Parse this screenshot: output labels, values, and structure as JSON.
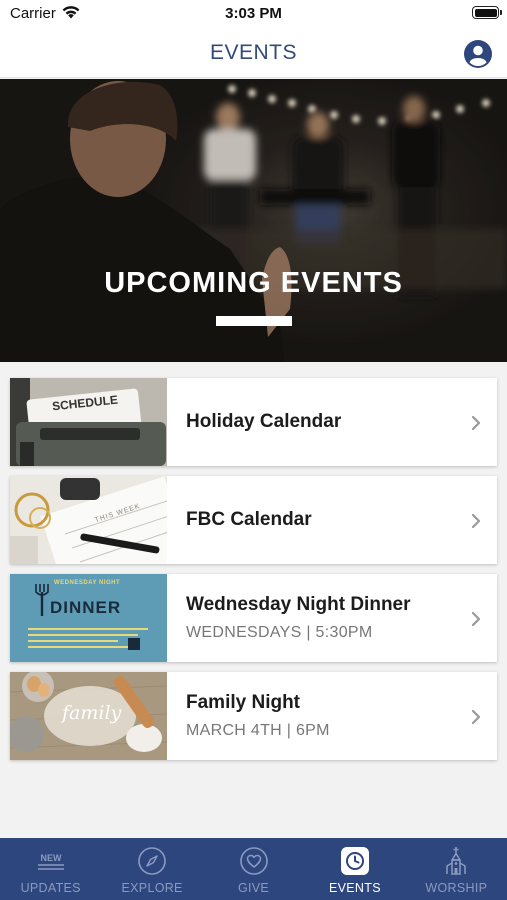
{
  "status_bar": {
    "carrier": "Carrier",
    "time": "3:03 PM"
  },
  "header": {
    "title": "EVENTS"
  },
  "hero": {
    "title": "UPCOMING EVENTS"
  },
  "events": [
    {
      "title": "Holiday Calendar",
      "subtitle": "",
      "thumb_text": "SCHEDULE"
    },
    {
      "title": "FBC Calendar",
      "subtitle": "",
      "thumb_text": "THIS WEEK"
    },
    {
      "title": "Wednesday Night Dinner",
      "subtitle": "WEDNESDAYS | 5:30PM",
      "thumb_text": "WEDNESDAY NIGHT",
      "thumb_text2": "DINNER"
    },
    {
      "title": "Family Night",
      "subtitle": "MARCH 4TH | 6PM",
      "thumb_text": "family"
    }
  ],
  "tabs": [
    {
      "label": "UPDATES",
      "icon": "new-badge-icon",
      "icon_text": "NEW"
    },
    {
      "label": "EXPLORE",
      "icon": "compass-icon"
    },
    {
      "label": "GIVE",
      "icon": "heart-icon"
    },
    {
      "label": "EVENTS",
      "icon": "clock-icon",
      "active": true
    },
    {
      "label": "WORSHIP",
      "icon": "church-icon"
    }
  ],
  "colors": {
    "brand": "#2e467e",
    "title": "#33497a",
    "tab_inactive": "#8b9ac0",
    "background": "#f2f2f2"
  }
}
